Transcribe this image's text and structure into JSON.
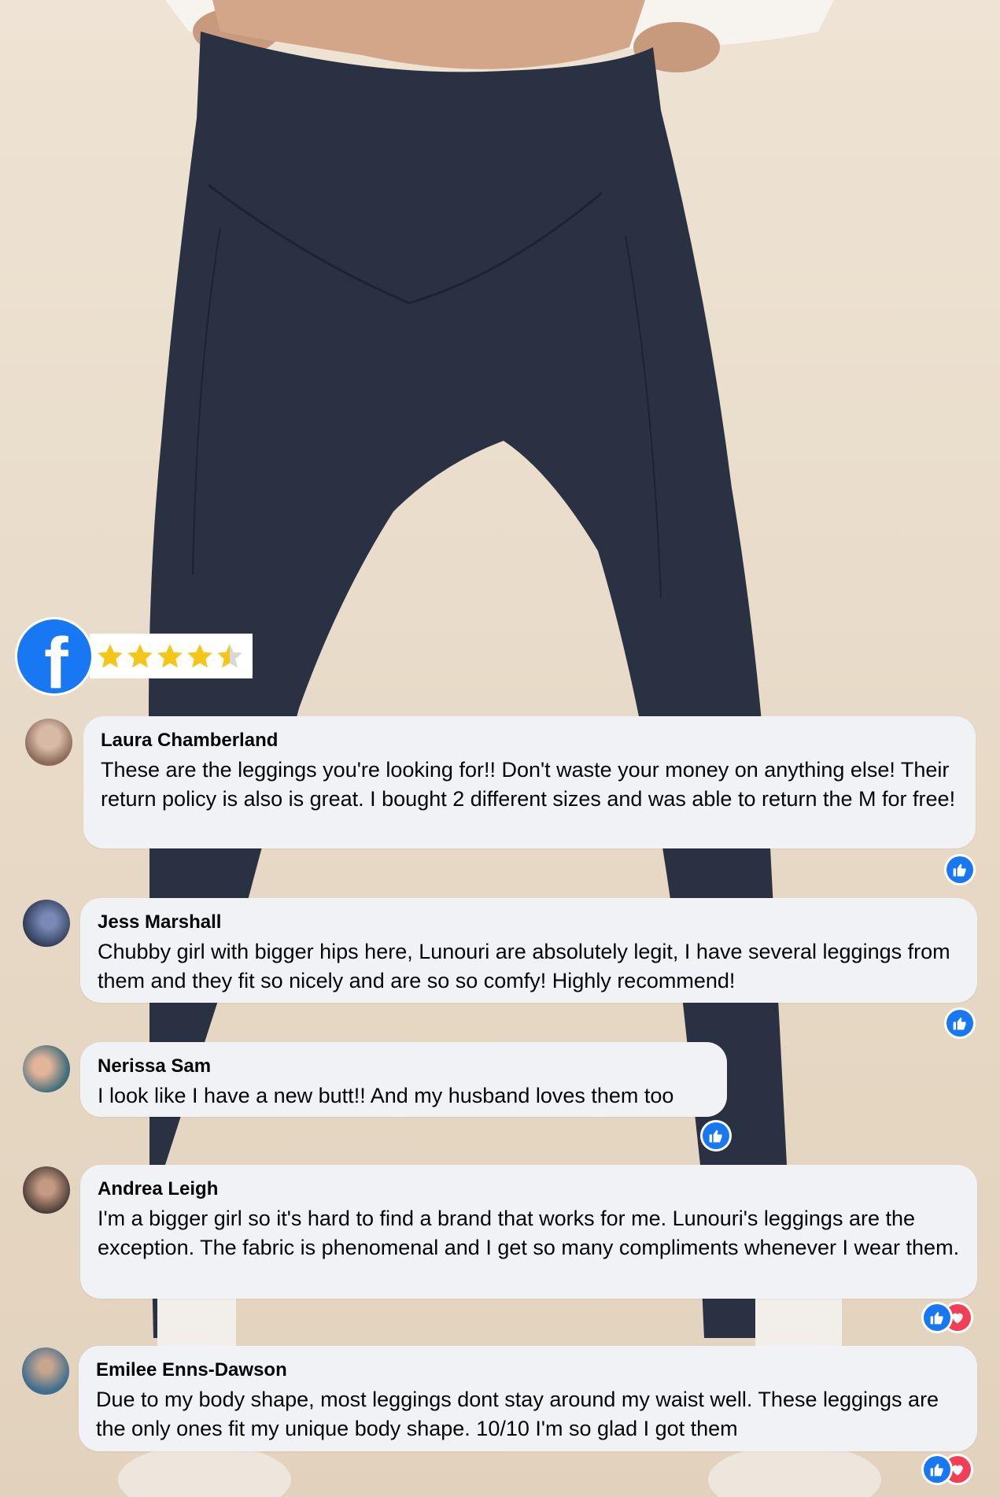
{
  "rating": {
    "platform_icon": "facebook-icon",
    "stars": 4.5,
    "max_stars": 5,
    "star_color": "#f5c518"
  },
  "colors": {
    "facebook_blue": "#1877f2",
    "love_red": "#f33e58",
    "bubble_bg": "#f0f2f5",
    "leggings": "#2a3142"
  },
  "comments": [
    {
      "name": "Laura Chamberland",
      "text": "These are the leggings you're looking for!! Don't waste your money on anything else! Their return policy is also is great. I bought 2 different sizes and was able to return the M for free!",
      "reactions": [
        "like"
      ]
    },
    {
      "name": "Jess Marshall",
      "text": "Chubby girl with bigger hips here, Lunouri are absolutely legit, I have several leggings from them and they fit so nicely and are so so comfy! Highly recommend!",
      "reactions": [
        "like"
      ]
    },
    {
      "name": "Nerissa Sam",
      "text": "I look like I have a new butt!! And my husband loves them too",
      "reactions": [
        "like"
      ]
    },
    {
      "name": "Andrea Leigh",
      "text": "I'm a bigger girl so it's hard to find a brand that works for me. Lunouri's leggings are the exception. The fabric is phenomenal and I get so many compliments whenever I wear them.",
      "reactions": [
        "like",
        "love"
      ]
    },
    {
      "name": "Emilee Enns-Dawson",
      "text": "Due to my body shape, most leggings dont stay around my waist well. These leggings are the only ones fit my unique body shape. 10/10 I'm so glad I got them",
      "reactions": [
        "like",
        "love"
      ]
    }
  ]
}
